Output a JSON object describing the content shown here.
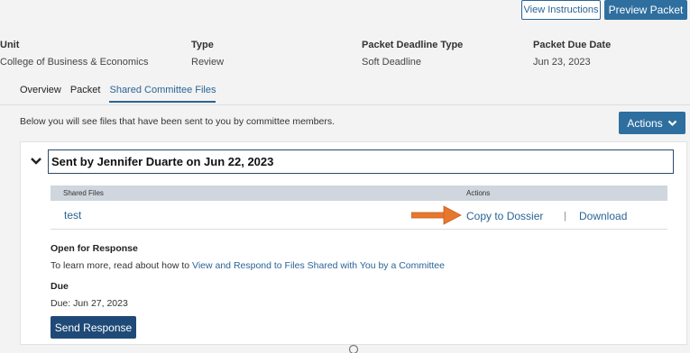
{
  "header": {
    "view_instructions_label": "View Instructions",
    "preview_packet_label": "Preview Packet"
  },
  "meta": {
    "unit_label": "Unit",
    "unit_value": "College of Business & Economics",
    "type_label": "Type",
    "type_value": "Review",
    "deadline_type_label": "Packet Deadline Type",
    "deadline_type_value": "Soft Deadline",
    "due_date_label": "Packet Due Date",
    "due_date_value": "Jun 23, 2023"
  },
  "tabs": [
    {
      "label": "Overview",
      "active": false
    },
    {
      "label": "Packet",
      "active": false
    },
    {
      "label": "Shared Committee Files",
      "active": true
    }
  ],
  "intro_text": "Below you will see files that have been sent to you by committee members.",
  "actions_label": "Actions",
  "shared_section": {
    "title": "Sent by Jennifer Duarte on Jun 22, 2023",
    "table_headers": {
      "files": "Shared Files",
      "actions": "Actions"
    },
    "rows": [
      {
        "file": "test",
        "copy_label": "Copy to Dossier",
        "separator": "|",
        "download_label": "Download"
      }
    ],
    "open_label": "Open for Response",
    "learn_text": "To learn more, read about how to ",
    "learn_link": "View and Respond to Files Shared with You by a Committee",
    "due_label": "Due",
    "due_value": "Due: Jun 27, 2023",
    "send_label": "Send Response"
  },
  "colors": {
    "accent": "#2f6f9f",
    "link": "#2a6496",
    "arrow": "#e8772e",
    "send_button": "#1f4a78"
  }
}
